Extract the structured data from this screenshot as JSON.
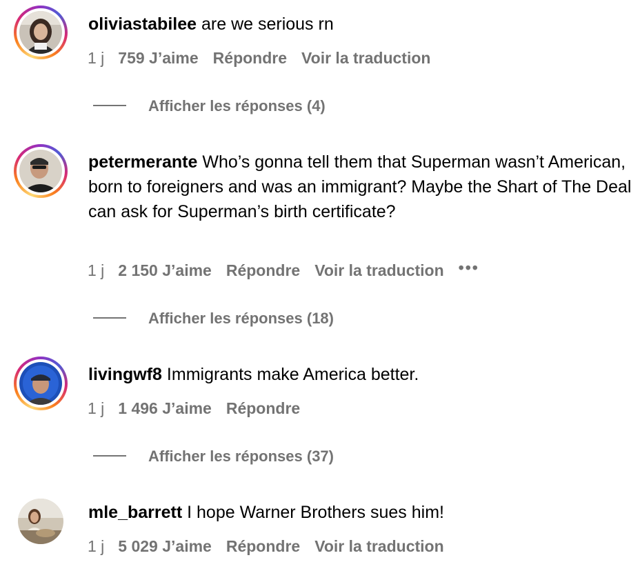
{
  "comments": [
    {
      "username": "oliviastabilee",
      "text": "are we serious rn",
      "time": "1 j",
      "likes": "759 J’aime",
      "reply": "Répondre",
      "translate": "Voir la traduction",
      "replies": "Afficher les réponses (4)"
    },
    {
      "username": "petermerante",
      "text": "Who’s gonna tell them that Superman wasn’t American, born to foreigners and was an immigrant? Maybe the Shart of The Deal can ask for Superman’s birth certificate?",
      "time": "1 j",
      "likes": "2 150 J’aime",
      "reply": "Répondre",
      "translate": "Voir la traduction",
      "more": "•••",
      "replies": "Afficher les réponses (18)"
    },
    {
      "username": "livingwf8",
      "text": "Immigrants make America better.",
      "time": "1 j",
      "likes": "1 496 J’aime",
      "reply": "Répondre",
      "replies": "Afficher les réponses (37)"
    },
    {
      "username": "mle_barrett",
      "text": "I hope Warner Brothers sues him!",
      "time": "1 j",
      "likes": "5 029 J’aime",
      "reply": "Répondre",
      "translate": "Voir la traduction"
    }
  ],
  "colors": {
    "meta": "#737373",
    "story_ring": "#d62976"
  }
}
